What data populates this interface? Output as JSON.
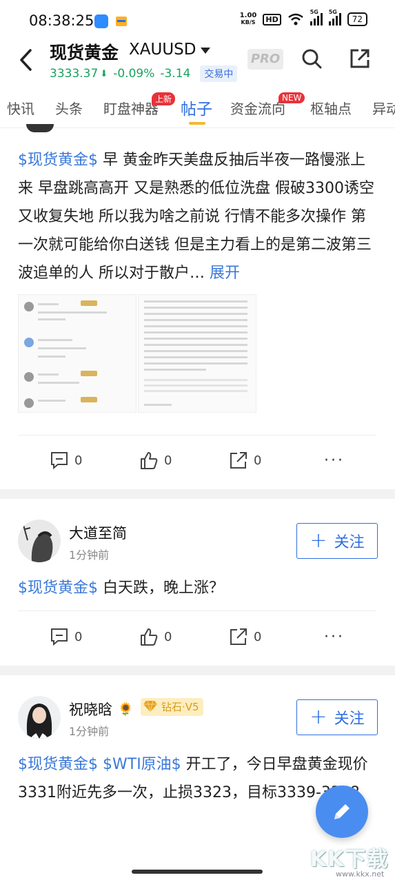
{
  "status_bar": {
    "time": "08:38:25",
    "net_speed_value": "1.00",
    "net_speed_unit": "KB/S",
    "hd_label": "HD",
    "signal_1": "5G",
    "signal_2": "5G",
    "battery": "72"
  },
  "header": {
    "title": "现货黄金",
    "symbol": "XAUUSD",
    "price": "3333.37",
    "change_pct": "-0.09%",
    "change_abs": "-3.14",
    "trade_status": "交易中",
    "pro_label": "PRO",
    "price_color": "#1aa260"
  },
  "tabs": {
    "items": [
      {
        "label": "快讯"
      },
      {
        "label": "头条"
      },
      {
        "label": "盯盘神器",
        "badge": "上新"
      },
      {
        "label": "帖子",
        "active": true
      },
      {
        "label": "资金流向",
        "badge": "NEW"
      },
      {
        "label": "枢轴点"
      },
      {
        "label": "异动"
      }
    ]
  },
  "posts": [
    {
      "tag": "$现货黄金$",
      "text": " 早 黄金昨天美盘反抽后半夜一路慢涨上来 早盘跳高高开 又是熟悉的低位洗盘 假破3300诱空又收复失地 所以我为啥之前说 行情不能多次操作 第一次就可能给你白送钱 但是主力看上的是第二波第三波追单的人 所以对于散户… ",
      "expand": "展开",
      "actions": {
        "comment": "0",
        "like": "0",
        "share": "0"
      }
    },
    {
      "user": "大道至简",
      "time": "1分钟前",
      "follow_label": "关注",
      "tag": "$现货黄金$",
      "text": " 白天跌，晚上涨？",
      "actions": {
        "comment": "0",
        "like": "0",
        "share": "0"
      }
    },
    {
      "user": "祝晓晗",
      "vip": "钻石·V5",
      "time": "1分钟前",
      "follow_label": "关注",
      "tag1": "$现货黄金$",
      "tag2": "$WTI原油$",
      "text": " 开工了，今日早盘黄金现价3331附近先多一次，止损3323，目标3339-3348"
    }
  ],
  "watermark": {
    "brand": "KK下载",
    "url": "www.kkx.net"
  },
  "colors": {
    "accent": "#2f6fe0",
    "tag": "#3a78d9",
    "badge_red": "#e7323b",
    "tab_indicator": "#f5b82e"
  }
}
